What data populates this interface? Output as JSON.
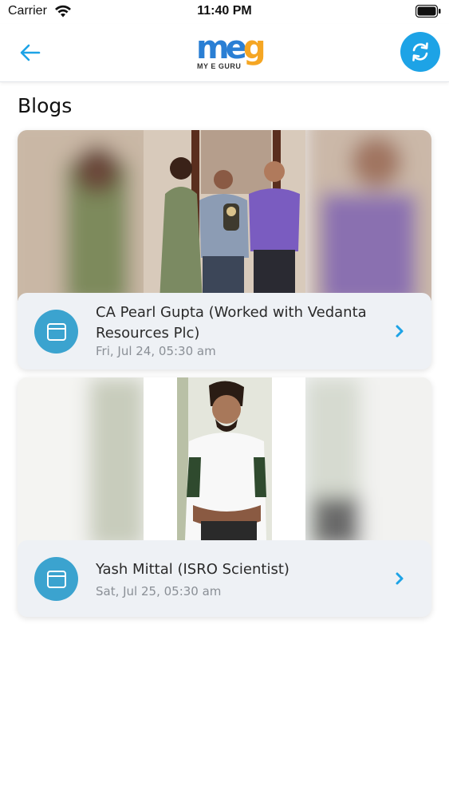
{
  "status_bar": {
    "carrier": "Carrier",
    "time": "11:40 PM"
  },
  "header": {
    "logo_text": "MY E GURU",
    "logo_letters": [
      "m",
      "e",
      "g"
    ],
    "back_icon": "arrow-left-icon",
    "refresh_icon": "refresh-icon"
  },
  "page": {
    "title": "Blogs"
  },
  "blogs": [
    {
      "title": "CA Pearl Gupta (Worked with Vedanta Resources Plc)",
      "date": "Fri, Jul 24, 05:30 am",
      "icon": "browser-window-icon"
    },
    {
      "title": "Yash Mittal (ISRO Scientist)",
      "date": "Sat, Jul 25, 05:30 am",
      "icon": "browser-window-icon"
    }
  ],
  "colors": {
    "accent": "#1da3e6",
    "icon_bg": "#3ba3cf",
    "chevron": "#1da3e6",
    "date": "#8a8f96"
  }
}
